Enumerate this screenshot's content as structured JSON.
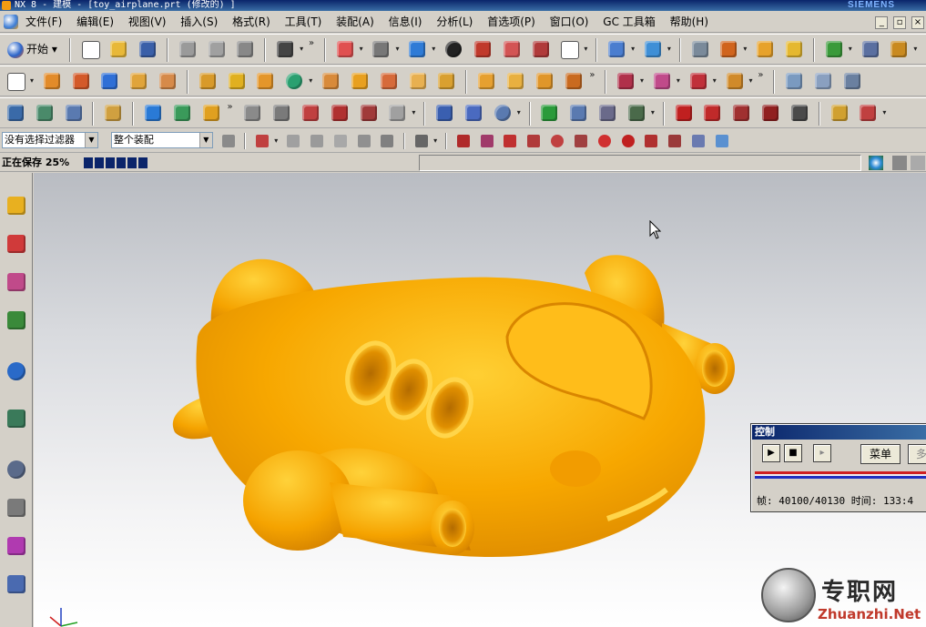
{
  "window": {
    "title": "NX 8 - 建模 - [toy_airplane.prt (修改的) ]",
    "brand": "SIEMENS"
  },
  "menubar": {
    "items": [
      "文件(F)",
      "编辑(E)",
      "视图(V)",
      "插入(S)",
      "格式(R)",
      "工具(T)",
      "装配(A)",
      "信息(I)",
      "分析(L)",
      "首选项(P)",
      "窗口(O)",
      "GC 工具箱",
      "帮助(H)"
    ],
    "window_controls": [
      "_",
      "▫",
      "×"
    ]
  },
  "toolbar1": {
    "start_label": "开始"
  },
  "filterbar": {
    "selection_filter": "没有选择过滤器",
    "assembly_scope": "整个装配"
  },
  "status": {
    "text": "正在保存 25%",
    "progress": 0.25
  },
  "control_panel": {
    "title": "控制",
    "play_icon": "play-step-icon",
    "stop_icon": "stop-icon",
    "menu_label": "菜单",
    "next_label": "多",
    "frame_info": "帧: 40100/40130 时间: 133:4"
  },
  "watermark": {
    "cn": "专职网",
    "en": "Zhuanzhi.Net"
  },
  "colors": {
    "model": "#f7a700",
    "model_highlight": "#ffd23a",
    "model_shadow": "#d98600",
    "titlebar": "#0a246a",
    "chrome": "#d4d0c8"
  }
}
